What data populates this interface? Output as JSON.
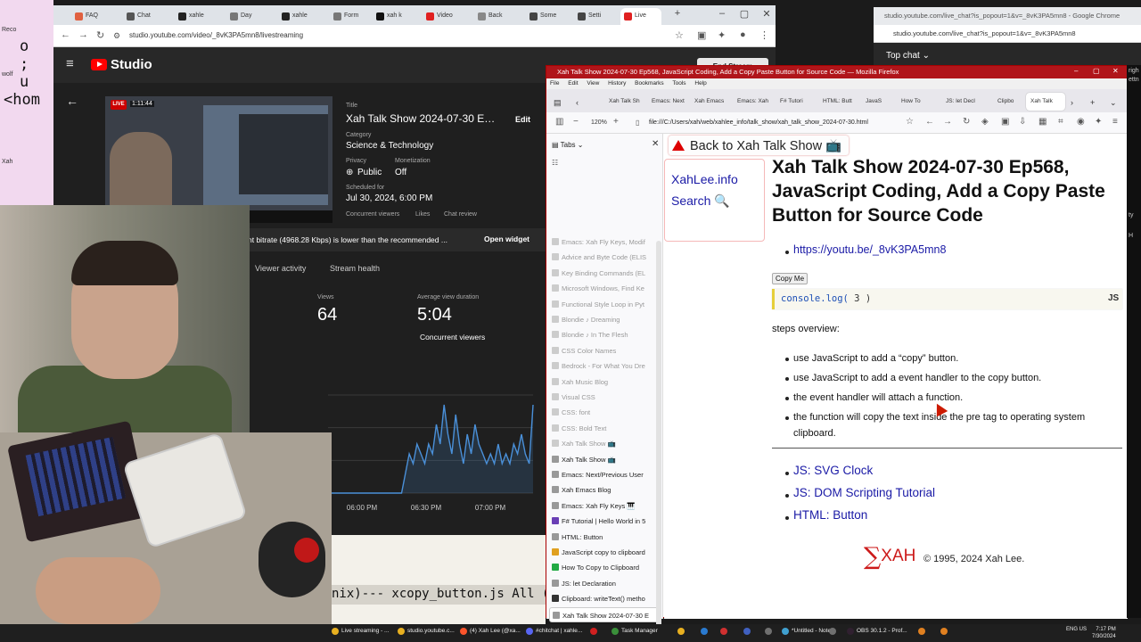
{
  "desktop": {
    "left_labels": [
      "Reco",
      "wolf",
      "Xah"
    ],
    "big_chars": [
      "o",
      ";",
      "u",
      "<hom"
    ]
  },
  "chrome": {
    "tabs": [
      {
        "label": "FAQ",
        "color": "#e06040"
      },
      {
        "label": "Chat",
        "color": "#555555"
      },
      {
        "label": "xahle",
        "color": "#222222"
      },
      {
        "label": "Day",
        "color": "#777777"
      },
      {
        "label": "xahle",
        "color": "#222222"
      },
      {
        "label": "Form",
        "color": "#777777"
      },
      {
        "label": "xah k",
        "color": "#111111"
      },
      {
        "label": "Video",
        "color": "#e02020"
      },
      {
        "label": "Back",
        "color": "#888888"
      },
      {
        "label": "Some",
        "color": "#444444"
      },
      {
        "label": "Setti",
        "color": "#444444"
      },
      {
        "label": "Live",
        "color": "#e02020"
      }
    ],
    "url": "studio.youtube.com/video/_8vK3PA5mn8/livestreaming"
  },
  "studio": {
    "logo": "Studio",
    "end_stream": "End Stream",
    "live_badge": "LIVE",
    "live_time": "1:11:44",
    "title_label": "Title",
    "title_value": "Xah Talk Show 2024-07-30 Ep5...",
    "edit": "Edit",
    "category_label": "Category",
    "category_value": "Science & Technology",
    "privacy_label": "Privacy",
    "privacy_value": "Public",
    "monetization_label": "Monetization",
    "monetization_value": "Off",
    "scheduled_label": "Scheduled for",
    "scheduled_value": "Jul 30, 2024, 6:00 PM",
    "sub_tabs": [
      "Concurrent viewers",
      "Likes",
      "Chat review"
    ],
    "bitrate_warning": "nt bitrate (4968.28 Kbps) is lower than the recommended ...",
    "open_widget": "Open widget",
    "tabs": [
      "Viewer activity",
      "Stream health"
    ],
    "views_label": "Views",
    "views_value": "64",
    "avg_label": "Average view duration",
    "avg_value": "5:04",
    "concurrent_label": "Concurrent viewers"
  },
  "chart_data": {
    "type": "area",
    "title": "Concurrent viewers",
    "xlabel": "",
    "ylabel": "",
    "x_ticks": [
      "06:00 PM",
      "06:30 PM",
      "07:00 PM"
    ],
    "grid": true,
    "series": [
      {
        "color": "#4a90d9",
        "values": [
          0,
          0,
          0,
          0,
          0,
          0,
          0,
          0,
          0,
          0,
          0,
          0,
          0,
          0,
          0,
          0,
          0,
          0,
          0,
          0,
          2,
          4,
          3,
          5,
          4,
          3,
          5,
          4,
          7,
          5,
          9,
          6,
          4,
          8,
          5,
          3,
          6,
          4,
          7,
          5,
          4,
          3,
          4,
          3,
          5,
          3,
          4,
          3,
          5,
          4,
          6,
          4,
          3,
          9
        ]
      }
    ],
    "ylim": [
      0,
      10
    ]
  },
  "terminal": {
    "modeline": "nix)--- xcopy_button.js All (1"
  },
  "popout": {
    "title": "studio.youtube.com/live_chat?is_popout=1&v=_8vK3PA5mn8 - Google Chrome",
    "url": "studio.youtube.com/live_chat?is_popout=1&v=_8vK3PA5mn8",
    "top_chat": "Top chat"
  },
  "firefox": {
    "title": "Xah Talk Show 2024-07-30 Ep568, JavaScript Coding, Add a Copy Paste Button for Source Code — Mozilla Firefox",
    "menu": [
      "File",
      "Edit",
      "View",
      "History",
      "Bookmarks",
      "Tools",
      "Help"
    ],
    "tabs": [
      "Xah Talk Sh",
      "Emacs: Next",
      "Xah Emacs",
      "Emacs: Xah",
      "F# Tutori",
      "HTML: Butt",
      "JavaS",
      "How To",
      "JS: let Decl",
      "Clipbo",
      "Xah Talk"
    ],
    "zoom": "120%",
    "url": "file:///C:/Users/xah/web/xahlee_info/talk_show/xah_talk_show_2024-07-30.html"
  },
  "sidebar": {
    "header": "Tabs",
    "items": [
      {
        "label": "Emacs: Xah Fly Keys, Modif",
        "loaded": false,
        "color": "#cccccc"
      },
      {
        "label": "Advice and Byte Code (ELIS",
        "loaded": false,
        "color": "#cccccc"
      },
      {
        "label": "Key Binding Commands (EL",
        "loaded": false,
        "color": "#cccccc"
      },
      {
        "label": "Microsoft Windows, Find Ke",
        "loaded": false,
        "color": "#cccccc"
      },
      {
        "label": "Functional Style Loop in Pyt",
        "loaded": false,
        "color": "#cccccc"
      },
      {
        "label": "Blondie ♪ Dreaming",
        "loaded": false,
        "color": "#cccccc"
      },
      {
        "label": "Blondie ♪ In The Flesh",
        "loaded": false,
        "color": "#cccccc"
      },
      {
        "label": "CSS Color Names",
        "loaded": false,
        "color": "#cccccc"
      },
      {
        "label": "Bedrock - For What You Dre",
        "loaded": false,
        "color": "#cccccc"
      },
      {
        "label": "Xah Music Blog",
        "loaded": false,
        "color": "#cccccc"
      },
      {
        "label": "Visual CSS",
        "loaded": false,
        "color": "#cccccc"
      },
      {
        "label": "CSS: font",
        "loaded": false,
        "color": "#cccccc"
      },
      {
        "label": "CSS: Bold Text",
        "loaded": false,
        "color": "#cccccc"
      },
      {
        "label": "Xah Talk Show 📺",
        "loaded": false,
        "color": "#cccccc"
      },
      {
        "label": "Xah Talk Show 📺",
        "loaded": true,
        "color": "#999999"
      },
      {
        "label": "Emacs: Next/Previous User",
        "loaded": true,
        "color": "#999999"
      },
      {
        "label": "Xah Emacs Blog",
        "loaded": true,
        "color": "#999999"
      },
      {
        "label": "Emacs: Xah Fly Keys 🎹",
        "loaded": true,
        "color": "#999999"
      },
      {
        "label": "F# Tutorial | Hello World in 5",
        "loaded": true,
        "color": "#6a3fb5"
      },
      {
        "label": "HTML: Button",
        "loaded": true,
        "color": "#999999"
      },
      {
        "label": "JavaScript copy to clipboard",
        "loaded": true,
        "color": "#e0a020"
      },
      {
        "label": "How To Copy to Clipboard",
        "loaded": true,
        "color": "#22aa44"
      },
      {
        "label": "JS: let Declaration",
        "loaded": true,
        "color": "#999999"
      },
      {
        "label": "Clipboard: writeText() metho",
        "loaded": true,
        "color": "#333333"
      },
      {
        "label": "Xah Talk Show 2024-07-30 E",
        "loaded": true,
        "current": true,
        "color": "#999999"
      }
    ]
  },
  "page": {
    "back_link": "Back to Xah Talk Show 📺",
    "nav_home": "XahLee.info",
    "nav_search": "Search 🔍",
    "title": "Xah Talk Show 2024-07-30 Ep568, JavaScript Coding, Add a Copy Paste Button for Source Code",
    "yt_link": "https://youtu.be/_8vK3PA5mn8",
    "copy_button": "Copy Me",
    "code_fn": "console.log(",
    "code_rest": " 3 )",
    "code_lang": "JS",
    "steps_header": "steps overview:",
    "steps": [
      "use JavaScript to add a “copy” button.",
      "use JavaScript to add a event handler to the copy button.",
      "the event handler will attach a function.",
      "the function will copy the text inside the pre tag to operating system clipboard."
    ],
    "related": [
      "JS: SVG Clock",
      "JS: DOM Scripting Tutorial",
      "HTML: Button"
    ],
    "logo_sigma": "∑",
    "logo_text": "XAH",
    "copyright": "© 1995, 2024 Xah Lee."
  },
  "right_strip": [
    "righ",
    "ettn",
    "ty",
    "H"
  ],
  "taskbar": {
    "items": [
      {
        "label": "Live streaming - ...",
        "color": "#e8b020"
      },
      {
        "label": "studio.youtube.c...",
        "color": "#e8b020"
      },
      {
        "label": "(4) Xah Lee (@xa...",
        "color": "#fb542b"
      },
      {
        "label": "#chitchat | xahle...",
        "color": "#5865f2"
      },
      {
        "label": "",
        "color": "#d02020"
      },
      {
        "label": "Task Manager",
        "color": "#3a8f3a"
      },
      {
        "label": "",
        "color": "#e8b020"
      },
      {
        "label": "",
        "color": "#2a7ad0"
      },
      {
        "label": "",
        "color": "#d03030"
      },
      {
        "label": "",
        "color": "#4060c0"
      },
      {
        "label": "",
        "color": "#707070"
      },
      {
        "label": "*Untitled - Note...",
        "color": "#40a0d0"
      },
      {
        "label": "",
        "color": "#707070"
      },
      {
        "label": "OBS 30.1.2 - Prof...",
        "color": "#302030"
      },
      {
        "label": "",
        "color": "#e08020"
      },
      {
        "label": "",
        "color": "#e08020"
      }
    ],
    "lang": "ENG US",
    "time": "7:17 PM",
    "date": "7/30/2024"
  }
}
